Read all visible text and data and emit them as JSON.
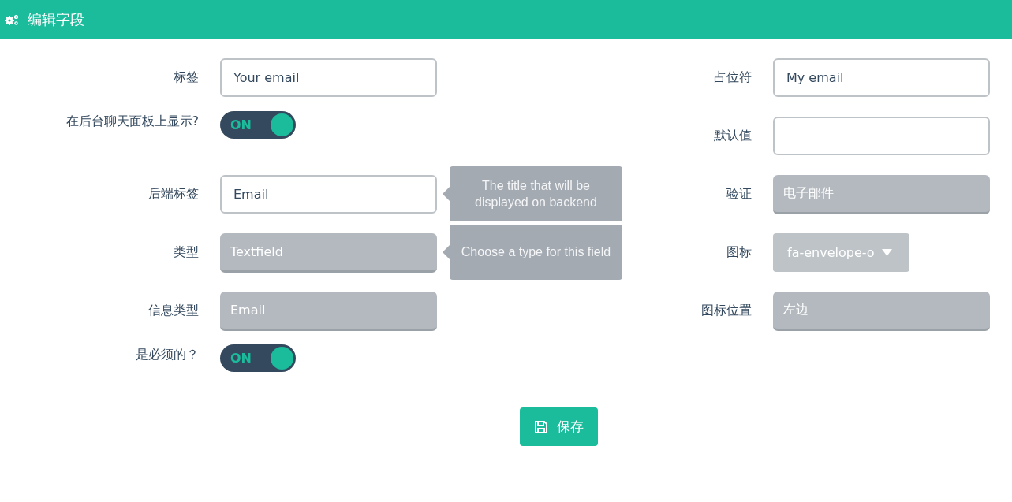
{
  "header": {
    "title": "编辑字段"
  },
  "left_fields": [
    {
      "label": "标签",
      "kind": "input",
      "value": "Your email"
    },
    {
      "label": "在后台聊天面板上显示?",
      "kind": "toggle",
      "on": true,
      "state_text": "ON"
    },
    {
      "label": "后端标签",
      "kind": "input",
      "value": "Email",
      "tooltip": "The title that will be displayed on backend"
    },
    {
      "label": "类型",
      "kind": "select",
      "value": "Textfield",
      "tooltip": "Choose a type for this field"
    },
    {
      "label": "信息类型",
      "kind": "select",
      "value": "Email"
    },
    {
      "label": "是必须的？",
      "kind": "toggle",
      "on": true,
      "state_text": "ON"
    }
  ],
  "right_fields": [
    {
      "label": "占位符",
      "kind": "input",
      "value": "My email"
    },
    {
      "label": "默认值",
      "kind": "input"
    },
    {
      "label": "验证",
      "kind": "select",
      "value": "电子邮件"
    },
    {
      "label": "图标",
      "kind": "dropdown",
      "value": "fa-envelope-o"
    },
    {
      "label": "图标位置",
      "kind": "select",
      "value": "左边"
    }
  ],
  "save_button": {
    "label": "保存"
  }
}
